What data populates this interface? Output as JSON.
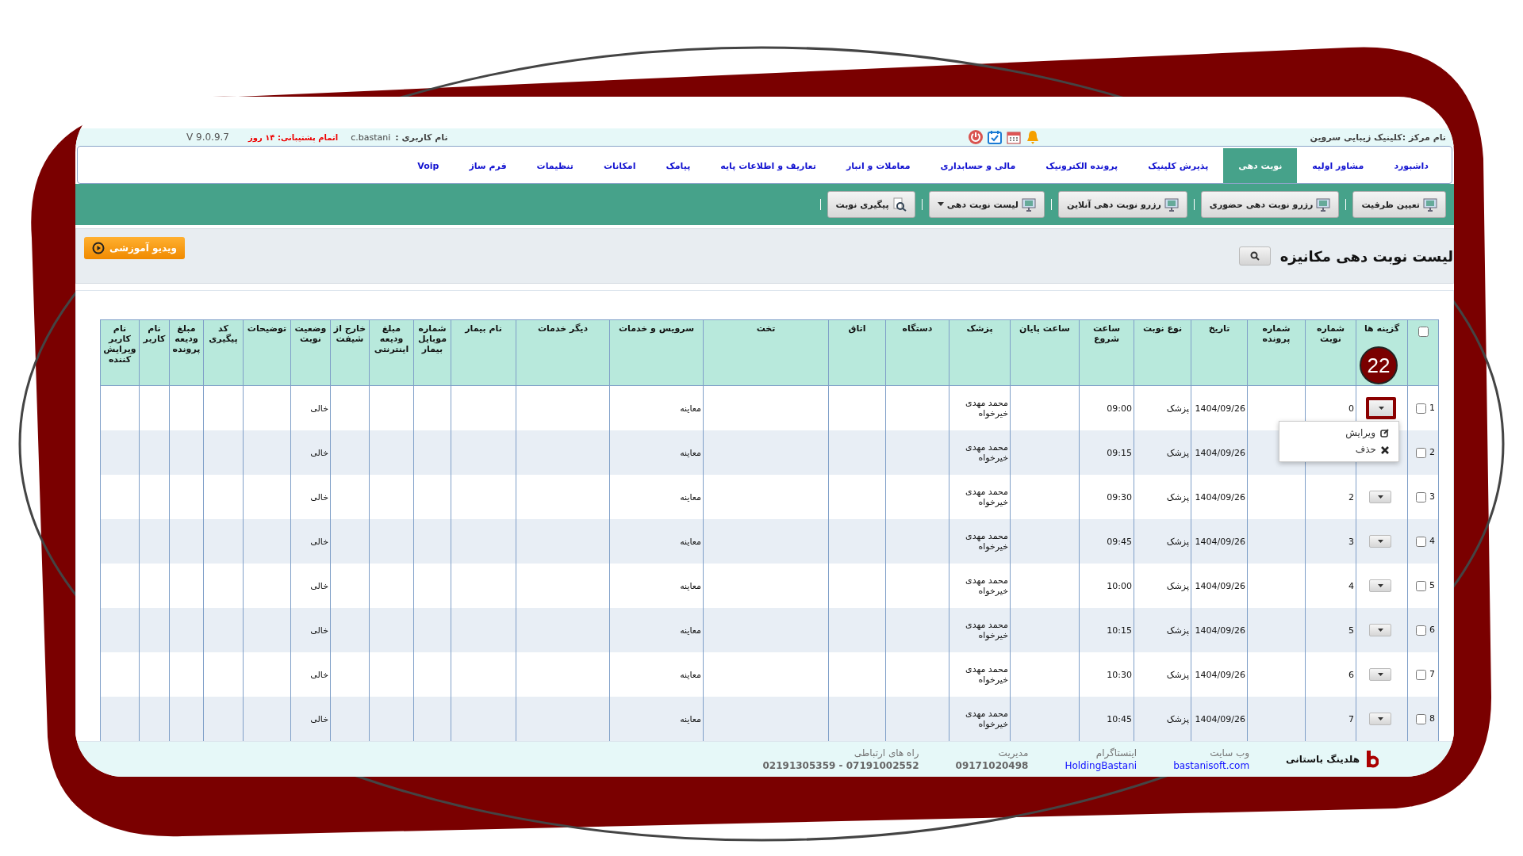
{
  "top_bar": {
    "center_name": "نام مرکز :کلینیک زیبایی سروین",
    "username_label": "نام کاربری :",
    "username": "c.bastani",
    "support": "اتمام پشتیبانی: ۱۴ روز",
    "version": "V 9.0.9.7"
  },
  "menu": [
    {
      "label": "داشبورد",
      "selected": false
    },
    {
      "label": "مشاور اولیه",
      "selected": false
    },
    {
      "label": "نوبت دهی",
      "selected": true
    },
    {
      "label": "پذیرش کلینیک",
      "selected": false
    },
    {
      "label": "پرونده الکترونیک",
      "selected": false
    },
    {
      "label": "مالی و حسابداری",
      "selected": false
    },
    {
      "label": "معاملات و انبار",
      "selected": false
    },
    {
      "label": "تعاریف و اطلاعات پایه",
      "selected": false
    },
    {
      "label": "پیامک",
      "selected": false
    },
    {
      "label": "امکانات",
      "selected": false
    },
    {
      "label": "تنظیمات",
      "selected": false
    },
    {
      "label": "فرم ساز",
      "selected": false
    },
    {
      "label": "Voip",
      "selected": false
    }
  ],
  "toolbar": [
    {
      "label": "تعیین ظرفیت",
      "kind": "monitor",
      "has_caret": false
    },
    {
      "label": "رزرو نوبت دهی حضوری",
      "kind": "monitor",
      "has_caret": false
    },
    {
      "label": "رزرو نوبت دهی آنلاین",
      "kind": "monitor",
      "has_caret": false
    },
    {
      "label": "لیست نوبت دهی",
      "kind": "monitor",
      "has_caret": true
    },
    {
      "label": "پیگیری نوبت",
      "kind": "search",
      "has_caret": false
    }
  ],
  "page_title": "لیست نوبت دهی مکانیزه",
  "video_button": "ویدیو آموزشی",
  "table": {
    "header_checkbox": {
      "checked": false
    },
    "columns": [
      "گزینه ها",
      "شماره نوبت",
      "شماره پرونده",
      "تاریخ",
      "نوع نوبت",
      "ساعت شروع",
      "ساعت پایان",
      "پزشک",
      "دستگاه",
      "اتاق",
      "تخت",
      "سرویس و خدمات",
      "دیگر خدمات",
      "نام بیمار",
      "شماره موبایل بیمار",
      "مبلغ ودیعه اینترنتی",
      "خارج از شیفت",
      "وضعیت نوبت",
      "توضیحات",
      "کد پیگیری",
      "مبلغ ودیعه پرونده",
      "نام کاربر",
      "نام کاربر ویرایش کننده"
    ],
    "rows": [
      {
        "number": "1",
        "checked": false,
        "highlighted": true,
        "queue_number": "0",
        "date": "1404/09/26",
        "type": "پزشک",
        "start_time": "09:00",
        "doctor": "محمد مهدی خیرخواه",
        "service": "معاینه",
        "status": "خالی",
        "menu": [
          {
            "label": "ویرایش",
            "kind": "edit"
          },
          {
            "label": "حذف",
            "kind": "delete"
          }
        ]
      },
      {
        "number": "2",
        "checked": false,
        "date": "1404/09/26",
        "type": "پزشک",
        "start_time": "09:15",
        "doctor": "محمد مهدی خیرخواه",
        "service": "معاینه",
        "status": "خالی"
      },
      {
        "number": "3",
        "checked": false,
        "highlighted": false,
        "queue_number": "2",
        "date": "1404/09/26",
        "type": "پزشک",
        "start_time": "09:30",
        "doctor": "محمد مهدی خیرخواه",
        "service": "معاینه",
        "status": "خالی"
      },
      {
        "number": "4",
        "checked": false,
        "highlighted": false,
        "queue_number": "3",
        "date": "1404/09/26",
        "type": "پزشک",
        "start_time": "09:45",
        "doctor": "محمد مهدی خیرخواه",
        "service": "معاینه",
        "status": "خالی"
      },
      {
        "number": "5",
        "checked": false,
        "highlighted": false,
        "queue_number": "4",
        "date": "1404/09/26",
        "type": "پزشک",
        "start_time": "10:00",
        "doctor": "محمد مهدی خیرخواه",
        "service": "معاینه",
        "status": "خالی"
      },
      {
        "number": "6",
        "checked": false,
        "highlighted": false,
        "queue_number": "5",
        "date": "1404/09/26",
        "type": "پزشک",
        "start_time": "10:15",
        "doctor": "محمد مهدی خیرخواه",
        "service": "معاینه",
        "status": "خالی"
      },
      {
        "number": "7",
        "checked": false,
        "highlighted": false,
        "queue_number": "6",
        "date": "1404/09/26",
        "type": "پزشک",
        "start_time": "10:30",
        "doctor": "محمد مهدی خیرخواه",
        "service": "معاینه",
        "status": "خالی"
      },
      {
        "number": "8",
        "checked": false,
        "highlighted": false,
        "queue_number": "7",
        "date": "1404/09/26",
        "type": "پزشک",
        "start_time": "10:45",
        "doctor": "محمد مهدی خیرخواه",
        "service": "معاینه",
        "status": "خالی"
      }
    ]
  },
  "step_badge": "22",
  "footer": {
    "company": "هلدینگ باستانی",
    "items": [
      {
        "label": "وب سایت",
        "value": "bastanisoft.com",
        "kind": "link"
      },
      {
        "label": "اینستاگرام",
        "value": "HoldingBastani",
        "kind": "link"
      },
      {
        "label": "مدیریت",
        "value": "09171020498",
        "kind": "text"
      },
      {
        "label": "راه های ارتباطی",
        "value": "07191002552 - 02191305359",
        "kind": "text"
      }
    ]
  }
}
